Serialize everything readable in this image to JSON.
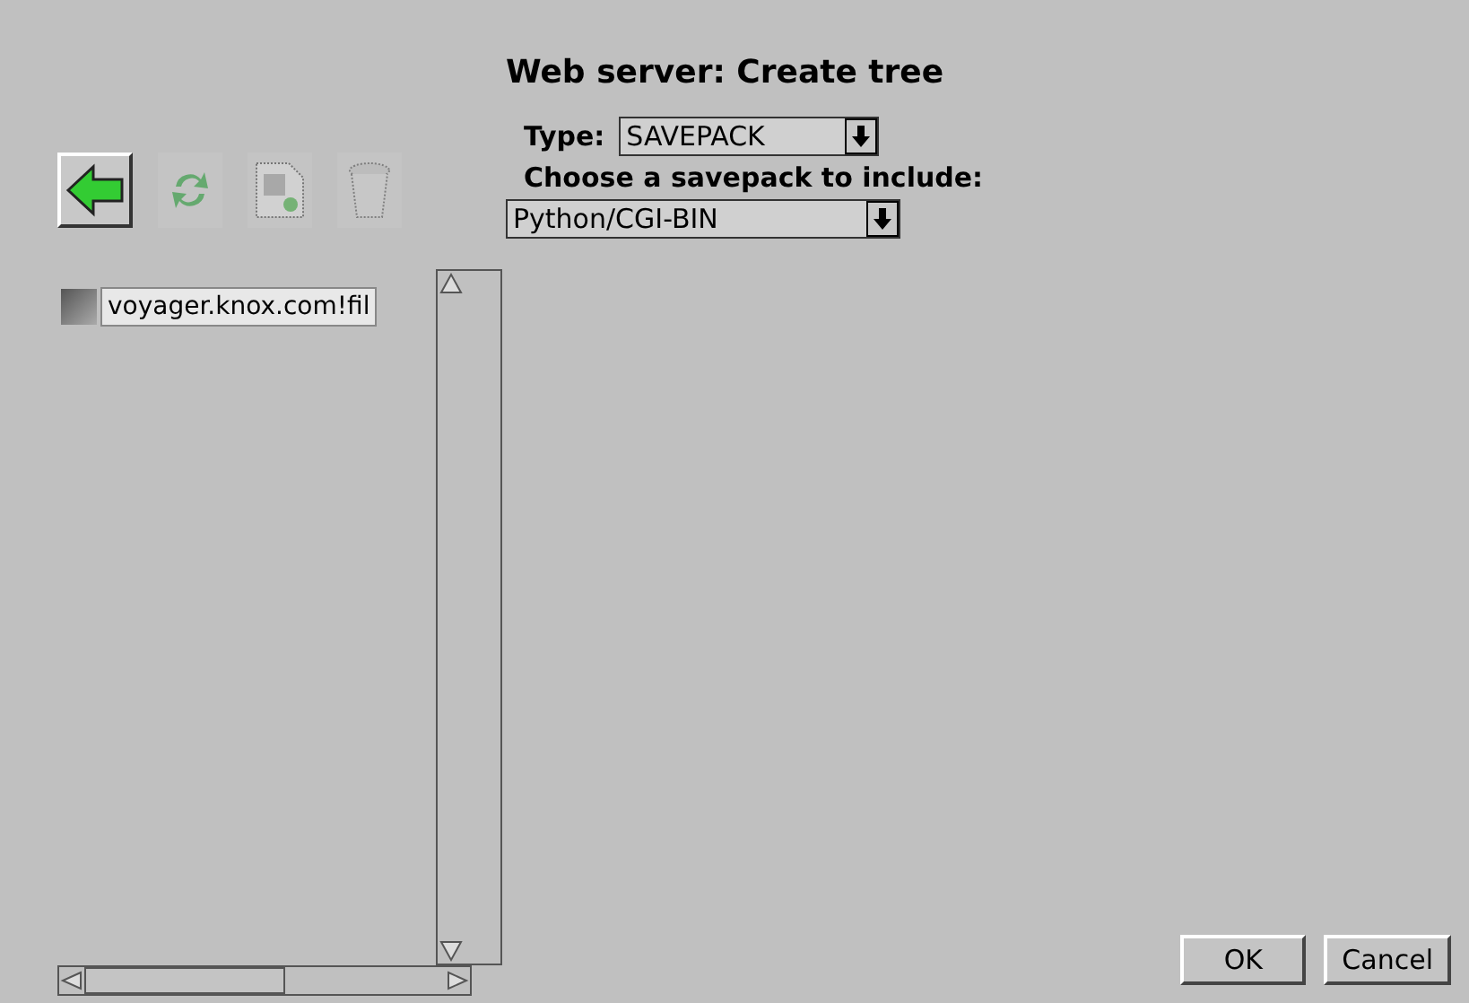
{
  "title": "Web server: Create tree",
  "toolbar": [
    {
      "kind": "back",
      "disabled": false
    },
    {
      "kind": "refresh",
      "disabled": true
    },
    {
      "kind": "new",
      "disabled": true
    },
    {
      "kind": "delete",
      "disabled": true
    }
  ],
  "tree": {
    "items": [
      {
        "label": "voyager.knox.com!fil"
      }
    ]
  },
  "type_field": {
    "label": "Type:",
    "value": "SAVEPACK"
  },
  "savepack": {
    "label": "Choose a savepack to include:",
    "value": "Python/CGI-BIN"
  },
  "buttons": [
    "OK",
    "Cancel"
  ]
}
